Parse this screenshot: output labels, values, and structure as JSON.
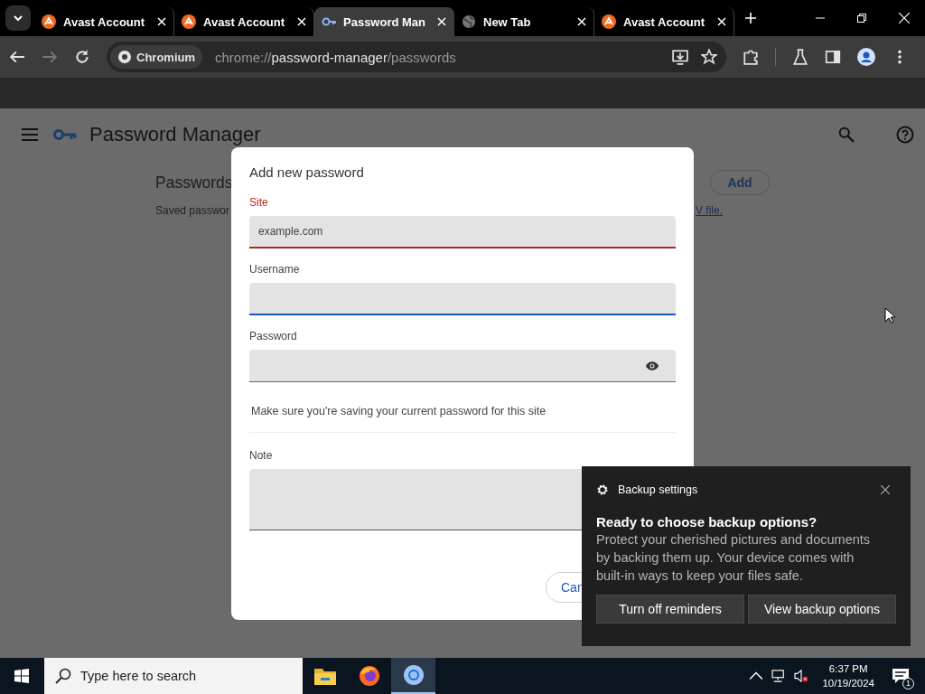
{
  "browser": {
    "tabs": [
      {
        "title": "Avast Account",
        "kind": "avast",
        "selected": false
      },
      {
        "title": "Avast Account",
        "kind": "avast",
        "selected": false
      },
      {
        "title": "Password Man",
        "kind": "key",
        "selected": true
      },
      {
        "title": "New Tab",
        "kind": "globe",
        "selected": false
      },
      {
        "title": "Avast Account",
        "kind": "avast",
        "selected": false
      }
    ],
    "address": {
      "chip": "Chromium",
      "scheme": "chrome://",
      "host": "password-manager",
      "path": "/passwords"
    }
  },
  "page": {
    "title": "Password Manager",
    "section_title": "Passwords",
    "description": "Saved passwor",
    "link": "V file.",
    "add_button": "Add"
  },
  "dialog": {
    "title": "Add new password",
    "fields": [
      {
        "label": "Site",
        "kind": "input",
        "placeholder": "example.com",
        "error": true,
        "focused": false
      },
      {
        "label": "Username",
        "kind": "input",
        "error": false,
        "focused": true
      },
      {
        "label": "Password",
        "kind": "password",
        "error": false,
        "focused": false
      }
    ],
    "hint": "Make sure you're saving your current password for this site",
    "note": {
      "label": "Note"
    },
    "cancel_button": "Can"
  },
  "notification": {
    "app": "Backup settings",
    "title": "Ready to choose backup options?",
    "body": "Protect your cherished pictures and documents by backing them up. Your device comes with built-in ways to keep your files safe.",
    "buttons": [
      "Turn off reminders",
      "View backup options"
    ]
  },
  "taskbar": {
    "search_placeholder": "Type here to search",
    "apps": [
      {
        "kind": "files",
        "selected": false
      },
      {
        "kind": "firefox",
        "selected": false
      },
      {
        "kind": "chromium",
        "selected": true
      }
    ],
    "time": "6:37 PM",
    "date": "10/19/2024",
    "notification_count": "1"
  }
}
